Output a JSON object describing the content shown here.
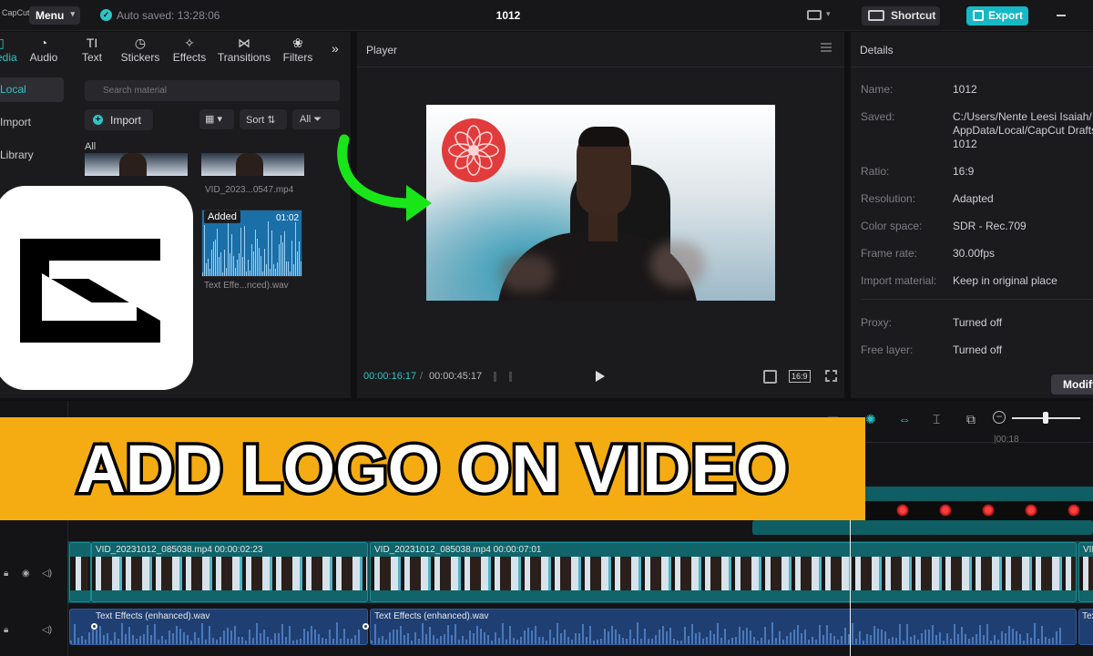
{
  "app": {
    "name": "CapCut",
    "menu_label": "Menu",
    "autosave": "Auto saved: 13:28:06",
    "project_title": "1012"
  },
  "toolbar": {
    "shortcut_label": "Shortcut",
    "export_label": "Export"
  },
  "media": {
    "tabs": [
      {
        "label": "Media",
        "icon": "media-icon"
      },
      {
        "label": "Audio",
        "icon": "audio-icon"
      },
      {
        "label": "Text",
        "icon": "text-icon"
      },
      {
        "label": "Stickers",
        "icon": "stickers-icon"
      },
      {
        "label": "Effects",
        "icon": "effects-icon"
      },
      {
        "label": "Transitions",
        "icon": "transitions-icon"
      },
      {
        "label": "Filters",
        "icon": "filters-icon"
      }
    ],
    "side_items": [
      "Local",
      "Import",
      "Library"
    ],
    "search_placeholder": "Search material",
    "import_label": "Import",
    "sort_label": "Sort",
    "filter_label": "All",
    "all_label": "All",
    "items": [
      {
        "name": "VID_2023...0547.mp4"
      },
      {
        "name": "Text Effe...nced).wav",
        "badge": "Added",
        "duration": "01:02"
      }
    ]
  },
  "player": {
    "title": "Player",
    "current_time": "00:00:16:17",
    "total_time": "00:00:45:17",
    "ratio": "16:9"
  },
  "details": {
    "title": "Details",
    "rows": [
      {
        "key": "Name:",
        "value": "1012"
      },
      {
        "key": "Saved:",
        "value": "C:/Users/Nente Leesi Isaiah/\nAppData/Local/CapCut Drafts/\n1012"
      },
      {
        "key": "Ratio:",
        "value": "16:9"
      },
      {
        "key": "Resolution:",
        "value": "Adapted"
      },
      {
        "key": "Color space:",
        "value": "SDR - Rec.709"
      },
      {
        "key": "Frame rate:",
        "value": "30.00fps"
      },
      {
        "key": "Import material:",
        "value": "Keep in original place"
      },
      {
        "key": "Proxy:",
        "value": "Turned off"
      },
      {
        "key": "Free layer:",
        "value": "Turned off"
      }
    ],
    "modify_label": "Modify"
  },
  "timeline": {
    "ruler_label": "|00:18",
    "clips": [
      {
        "label": "VID_20231012_085038.mp4   00:00:02:23"
      },
      {
        "label": "VID_20231012_085038.mp4   00:00:07:01"
      },
      {
        "label": "VID"
      }
    ],
    "audio_clips": [
      {
        "label": "Text Effects (enhanced).wav"
      },
      {
        "label": "Text Effects (enhanced).wav"
      },
      {
        "label": "Tex"
      }
    ]
  },
  "banner": {
    "text": "ADD LOGO ON VIDEO",
    "color": "#f4ac12"
  },
  "colors": {
    "accent": "#2ec4c4",
    "export": "#15b8c4",
    "logo_red": "#e23b3b"
  }
}
